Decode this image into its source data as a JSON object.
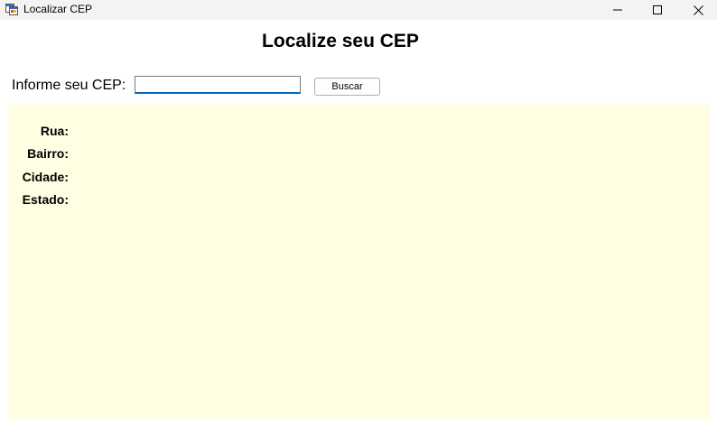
{
  "window": {
    "title": "Localizar CEP",
    "minimize_icon": "minimize-icon",
    "maximize_icon": "maximize-icon",
    "close_icon": "close-icon"
  },
  "header": {
    "title": "Localize seu CEP"
  },
  "search": {
    "label": "Informe seu CEP:",
    "value": "",
    "button_label": "Buscar"
  },
  "result": {
    "background": "#fffee2",
    "fields": {
      "rua": "Rua:",
      "bairro": "Bairro:",
      "cidade": "Cidade:",
      "estado": "Estado:"
    }
  }
}
